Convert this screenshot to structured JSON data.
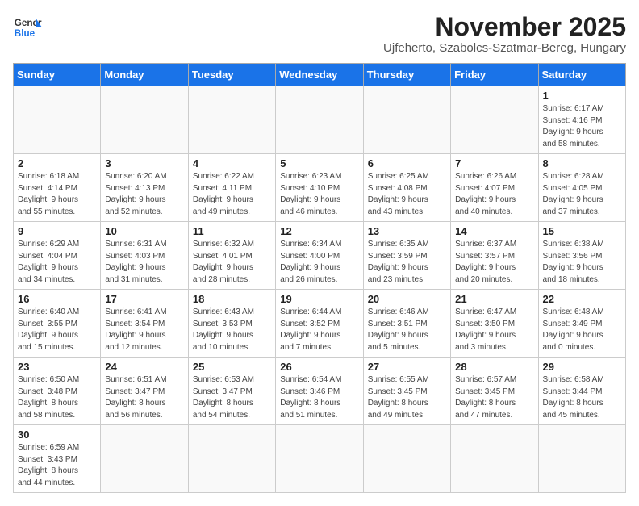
{
  "header": {
    "logo_general": "General",
    "logo_blue": "Blue",
    "month": "November 2025",
    "location": "Ujfeherto, Szabolcs-Szatmar-Bereg, Hungary"
  },
  "weekdays": [
    "Sunday",
    "Monday",
    "Tuesday",
    "Wednesday",
    "Thursday",
    "Friday",
    "Saturday"
  ],
  "weeks": [
    [
      {
        "day": "",
        "info": ""
      },
      {
        "day": "",
        "info": ""
      },
      {
        "day": "",
        "info": ""
      },
      {
        "day": "",
        "info": ""
      },
      {
        "day": "",
        "info": ""
      },
      {
        "day": "",
        "info": ""
      },
      {
        "day": "1",
        "info": "Sunrise: 6:17 AM\nSunset: 4:16 PM\nDaylight: 9 hours\nand 58 minutes."
      }
    ],
    [
      {
        "day": "2",
        "info": "Sunrise: 6:18 AM\nSunset: 4:14 PM\nDaylight: 9 hours\nand 55 minutes."
      },
      {
        "day": "3",
        "info": "Sunrise: 6:20 AM\nSunset: 4:13 PM\nDaylight: 9 hours\nand 52 minutes."
      },
      {
        "day": "4",
        "info": "Sunrise: 6:22 AM\nSunset: 4:11 PM\nDaylight: 9 hours\nand 49 minutes."
      },
      {
        "day": "5",
        "info": "Sunrise: 6:23 AM\nSunset: 4:10 PM\nDaylight: 9 hours\nand 46 minutes."
      },
      {
        "day": "6",
        "info": "Sunrise: 6:25 AM\nSunset: 4:08 PM\nDaylight: 9 hours\nand 43 minutes."
      },
      {
        "day": "7",
        "info": "Sunrise: 6:26 AM\nSunset: 4:07 PM\nDaylight: 9 hours\nand 40 minutes."
      },
      {
        "day": "8",
        "info": "Sunrise: 6:28 AM\nSunset: 4:05 PM\nDaylight: 9 hours\nand 37 minutes."
      }
    ],
    [
      {
        "day": "9",
        "info": "Sunrise: 6:29 AM\nSunset: 4:04 PM\nDaylight: 9 hours\nand 34 minutes."
      },
      {
        "day": "10",
        "info": "Sunrise: 6:31 AM\nSunset: 4:03 PM\nDaylight: 9 hours\nand 31 minutes."
      },
      {
        "day": "11",
        "info": "Sunrise: 6:32 AM\nSunset: 4:01 PM\nDaylight: 9 hours\nand 28 minutes."
      },
      {
        "day": "12",
        "info": "Sunrise: 6:34 AM\nSunset: 4:00 PM\nDaylight: 9 hours\nand 26 minutes."
      },
      {
        "day": "13",
        "info": "Sunrise: 6:35 AM\nSunset: 3:59 PM\nDaylight: 9 hours\nand 23 minutes."
      },
      {
        "day": "14",
        "info": "Sunrise: 6:37 AM\nSunset: 3:57 PM\nDaylight: 9 hours\nand 20 minutes."
      },
      {
        "day": "15",
        "info": "Sunrise: 6:38 AM\nSunset: 3:56 PM\nDaylight: 9 hours\nand 18 minutes."
      }
    ],
    [
      {
        "day": "16",
        "info": "Sunrise: 6:40 AM\nSunset: 3:55 PM\nDaylight: 9 hours\nand 15 minutes."
      },
      {
        "day": "17",
        "info": "Sunrise: 6:41 AM\nSunset: 3:54 PM\nDaylight: 9 hours\nand 12 minutes."
      },
      {
        "day": "18",
        "info": "Sunrise: 6:43 AM\nSunset: 3:53 PM\nDaylight: 9 hours\nand 10 minutes."
      },
      {
        "day": "19",
        "info": "Sunrise: 6:44 AM\nSunset: 3:52 PM\nDaylight: 9 hours\nand 7 minutes."
      },
      {
        "day": "20",
        "info": "Sunrise: 6:46 AM\nSunset: 3:51 PM\nDaylight: 9 hours\nand 5 minutes."
      },
      {
        "day": "21",
        "info": "Sunrise: 6:47 AM\nSunset: 3:50 PM\nDaylight: 9 hours\nand 3 minutes."
      },
      {
        "day": "22",
        "info": "Sunrise: 6:48 AM\nSunset: 3:49 PM\nDaylight: 9 hours\nand 0 minutes."
      }
    ],
    [
      {
        "day": "23",
        "info": "Sunrise: 6:50 AM\nSunset: 3:48 PM\nDaylight: 8 hours\nand 58 minutes."
      },
      {
        "day": "24",
        "info": "Sunrise: 6:51 AM\nSunset: 3:47 PM\nDaylight: 8 hours\nand 56 minutes."
      },
      {
        "day": "25",
        "info": "Sunrise: 6:53 AM\nSunset: 3:47 PM\nDaylight: 8 hours\nand 54 minutes."
      },
      {
        "day": "26",
        "info": "Sunrise: 6:54 AM\nSunset: 3:46 PM\nDaylight: 8 hours\nand 51 minutes."
      },
      {
        "day": "27",
        "info": "Sunrise: 6:55 AM\nSunset: 3:45 PM\nDaylight: 8 hours\nand 49 minutes."
      },
      {
        "day": "28",
        "info": "Sunrise: 6:57 AM\nSunset: 3:45 PM\nDaylight: 8 hours\nand 47 minutes."
      },
      {
        "day": "29",
        "info": "Sunrise: 6:58 AM\nSunset: 3:44 PM\nDaylight: 8 hours\nand 45 minutes."
      }
    ],
    [
      {
        "day": "30",
        "info": "Sunrise: 6:59 AM\nSunset: 3:43 PM\nDaylight: 8 hours\nand 44 minutes."
      },
      {
        "day": "",
        "info": ""
      },
      {
        "day": "",
        "info": ""
      },
      {
        "day": "",
        "info": ""
      },
      {
        "day": "",
        "info": ""
      },
      {
        "day": "",
        "info": ""
      },
      {
        "day": "",
        "info": ""
      }
    ]
  ]
}
